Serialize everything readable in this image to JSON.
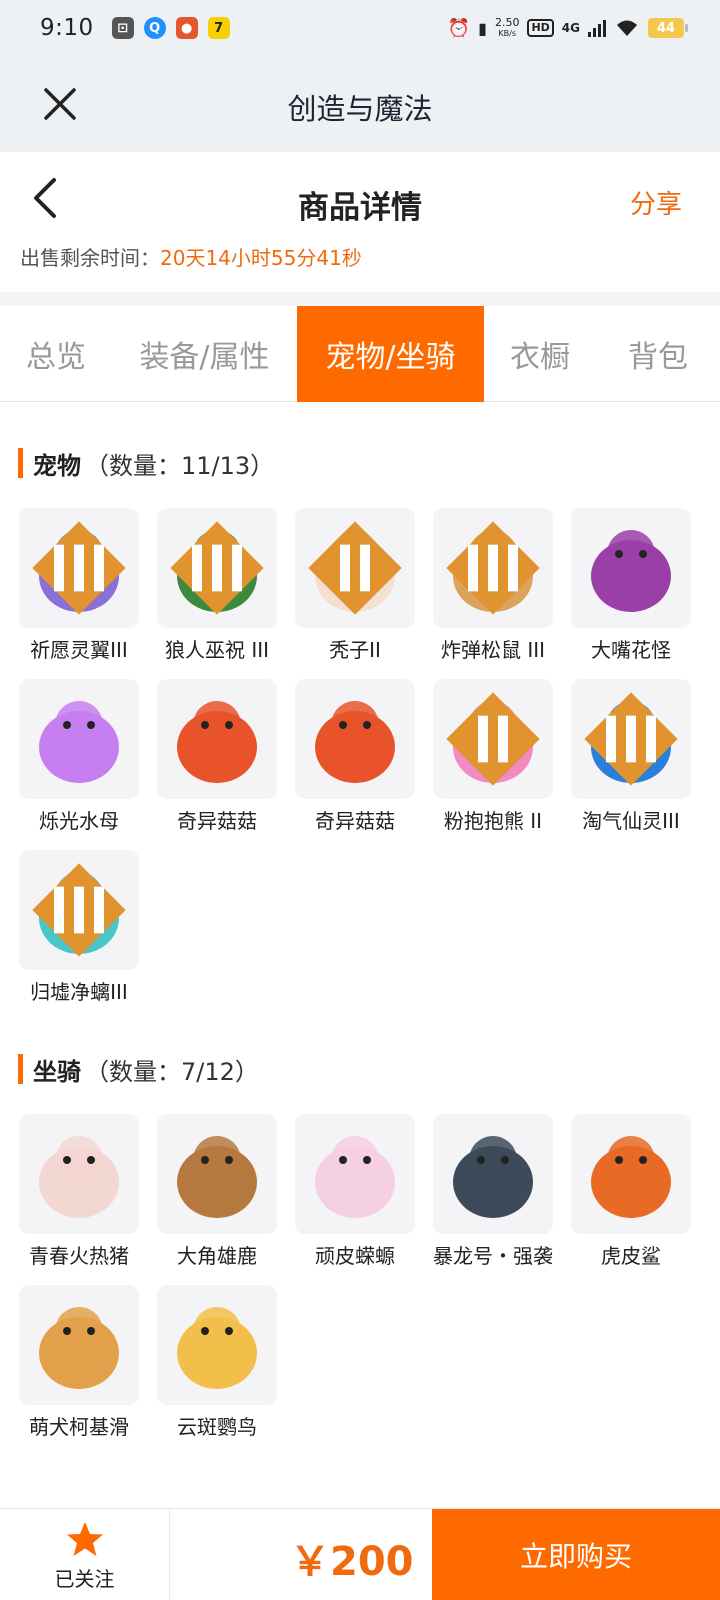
{
  "status_bar": {
    "time": "9:10",
    "net_speed": "2.50",
    "net_unit": "KB/s",
    "hd_label": "HD",
    "network": "4G",
    "battery": "44"
  },
  "webview": {
    "title": "创造与魔法"
  },
  "header": {
    "title": "商品详情",
    "share_label": "分享",
    "timer_label": "出售剩余时间：",
    "timer_value": "20天14小时55分41秒"
  },
  "tabs": [
    {
      "label": "总览",
      "active": false
    },
    {
      "label": "装备/属性",
      "active": false
    },
    {
      "label": "宠物/坐骑",
      "active": true
    },
    {
      "label": "衣橱",
      "active": false
    },
    {
      "label": "背包",
      "active": false
    }
  ],
  "pets": {
    "title": "宠物",
    "count": "（数量：11/13）",
    "items": [
      {
        "name": "祈愿灵翼III",
        "rank": "III",
        "icon": "bird-icon",
        "color": "#8a6fd6"
      },
      {
        "name": "狼人巫祝 III",
        "rank": "III",
        "icon": "wolf-shaman-icon",
        "color": "#3d8a3f"
      },
      {
        "name": "秃子II",
        "rank": "II",
        "icon": "bald-head-icon",
        "color": "#f2e1d0"
      },
      {
        "name": "炸弹松鼠 III",
        "rank": "III",
        "icon": "squirrel-icon",
        "color": "#d9a45a"
      },
      {
        "name": "大嘴花怪",
        "rank": "",
        "icon": "flower-monster-icon",
        "color": "#9b3fa8"
      },
      {
        "name": "烁光水母",
        "rank": "",
        "icon": "jellyfish-icon",
        "color": "#c77ef0"
      },
      {
        "name": "奇异菇菇",
        "rank": "",
        "icon": "mushroom-icon",
        "color": "#e8532b"
      },
      {
        "name": "奇异菇菇",
        "rank": "",
        "icon": "mushroom-icon",
        "color": "#e8532b"
      },
      {
        "name": "粉抱抱熊 II",
        "rank": "II",
        "icon": "pink-bear-icon",
        "color": "#f08ac0"
      },
      {
        "name": "淘气仙灵III",
        "rank": "III",
        "icon": "blue-spirit-icon",
        "color": "#2a7fd8"
      },
      {
        "name": "归墟净螭III",
        "rank": "III",
        "icon": "dragon-icon",
        "color": "#48c6c9"
      }
    ]
  },
  "mounts": {
    "title": "坐骑",
    "count": "（数量：7/12）",
    "items": [
      {
        "name": "青春火热猪",
        "rank": "",
        "icon": "pig-icon",
        "color": "#f3d7d2"
      },
      {
        "name": "大角雄鹿",
        "rank": "",
        "icon": "deer-icon",
        "color": "#b5793f"
      },
      {
        "name": "顽皮蝾螈",
        "rank": "",
        "icon": "axolotl-icon",
        "color": "#f5cfe2"
      },
      {
        "name": "暴龙号・强袭",
        "rank": "",
        "icon": "mech-dragon-icon",
        "color": "#3c4a5a"
      },
      {
        "name": "虎皮鲨",
        "rank": "",
        "icon": "shark-icon",
        "color": "#e86a24"
      },
      {
        "name": "萌犬柯基滑",
        "rank": "",
        "icon": "corgi-icon",
        "color": "#e3a04a"
      },
      {
        "name": "云斑鹦鸟",
        "rank": "",
        "icon": "parrot-icon",
        "color": "#f2c04a"
      }
    ]
  },
  "bottom": {
    "follow_label": "已关注",
    "price": "￥200",
    "buy_label": "立即购买"
  }
}
